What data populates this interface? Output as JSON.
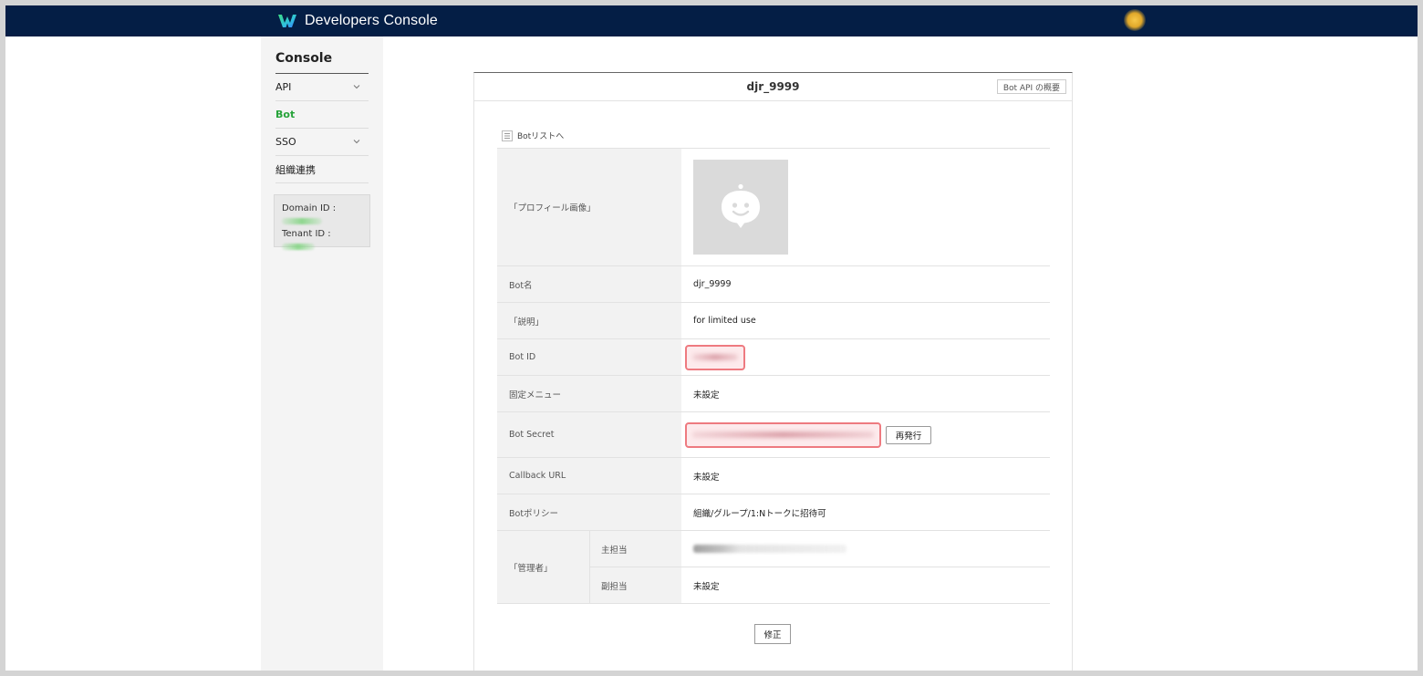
{
  "header": {
    "brand_title": "Developers Console",
    "logo_icon": "works-logo-icon",
    "accent": "#041e45"
  },
  "sidebar": {
    "title": "Console",
    "items": [
      {
        "label": "API",
        "has_chevron": true
      },
      {
        "label": "Bot",
        "active": true
      },
      {
        "label": "SSO",
        "has_chevron": true
      },
      {
        "label": "組織連携"
      }
    ],
    "domain_id_label": "Domain ID :",
    "tenant_id_label": "Tenant ID :"
  },
  "card": {
    "title": "djr_9999",
    "overview_button": "Bot API の概要",
    "back_link": "Botリストへ",
    "rows": {
      "profile_image": "「プロフィール画像」",
      "bot_name_label": "Bot名",
      "bot_name_value": "djr_9999",
      "description_label": "「説明」",
      "description_value": "for limited use",
      "bot_id_label": "Bot ID",
      "fixed_menu_label": "固定メニュー",
      "fixed_menu_value": "未設定",
      "bot_secret_label": "Bot Secret",
      "reissue_button": "再発行",
      "callback_url_label": "Callback URL",
      "callback_url_value": "未設定",
      "bot_policy_label": "Botポリシー",
      "bot_policy_value": "組織/グループ/1:Nトークに招待可",
      "manager_label": "「管理者」",
      "primary_label": "主担当",
      "secondary_label": "副担当",
      "secondary_value": "未設定"
    },
    "edit_button": "修正"
  },
  "colors": {
    "active_nav": "#27a33a",
    "highlight_border": "#ee7a80"
  }
}
